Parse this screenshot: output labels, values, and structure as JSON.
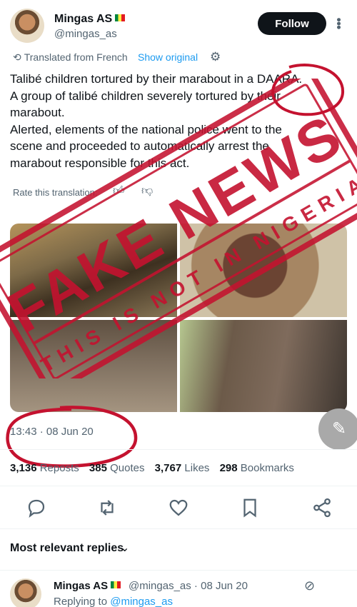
{
  "author": {
    "name": "Mingas AS",
    "handle": "@mingas_as",
    "follow_label": "Follow"
  },
  "translation": {
    "label": "Translated from French",
    "show_original": "Show original",
    "rate_label": "Rate this translation:"
  },
  "post": {
    "lines": [
      "Talibé children tortured by their marabout in a DAARA.",
      "A group of talibé children severely tortured by their",
      "marabout.",
      "Alerted, elements of the national police went to the",
      "scene and proceeded to automatically arrest the",
      "marabout responsible for this act."
    ],
    "timestamp": "13:43 · 08 Jun 20"
  },
  "overlay": {
    "stamp_main": "FAKE NEWS",
    "stamp_sub": "THIS IS NOT IN NIGERIA",
    "stamp_color": "#c4122f"
  },
  "stats": {
    "reposts_count": "3,136",
    "reposts_label": "Reposts",
    "quotes_count": "385",
    "quotes_label": "Quotes",
    "likes_count": "3,767",
    "likes_label": "Likes",
    "bookmarks_count": "298",
    "bookmarks_label": "Bookmarks"
  },
  "actions": [
    "reply-icon",
    "repost-icon",
    "like-icon",
    "bookmark-icon",
    "share-icon"
  ],
  "replies": {
    "sort_label": "Most relevant replies",
    "first": {
      "name": "Mingas AS",
      "handle_date": "@mingas_as · 08 Jun 20",
      "replying_prefix": "Replying to",
      "replying_handle": "@mingas_as"
    }
  }
}
